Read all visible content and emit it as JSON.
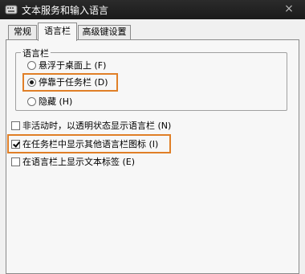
{
  "window": {
    "title": "文本服务和输入语言",
    "close_glyph": "×"
  },
  "tabs": [
    {
      "label": "常规",
      "active": false
    },
    {
      "label": "语言栏",
      "active": true
    },
    {
      "label": "高级键设置",
      "active": false
    }
  ],
  "language_bar_group": {
    "title": "语言栏",
    "options": [
      {
        "label": "悬浮于桌面上 (F)",
        "selected": false
      },
      {
        "label": "停靠于任务栏 (D)",
        "selected": true
      },
      {
        "label": "隐藏 (H)",
        "selected": false
      }
    ]
  },
  "checkboxes": [
    {
      "label": "非活动时，以透明状态显示语言栏 (N)",
      "checked": false
    },
    {
      "label": "在任务栏中显示其他语言栏图标 (I)",
      "checked": true
    },
    {
      "label": "在语言栏上显示文本标签 (E)",
      "checked": false
    }
  ],
  "colors": {
    "highlight": "#e07f27",
    "titlebar": "#1f1f1f"
  }
}
